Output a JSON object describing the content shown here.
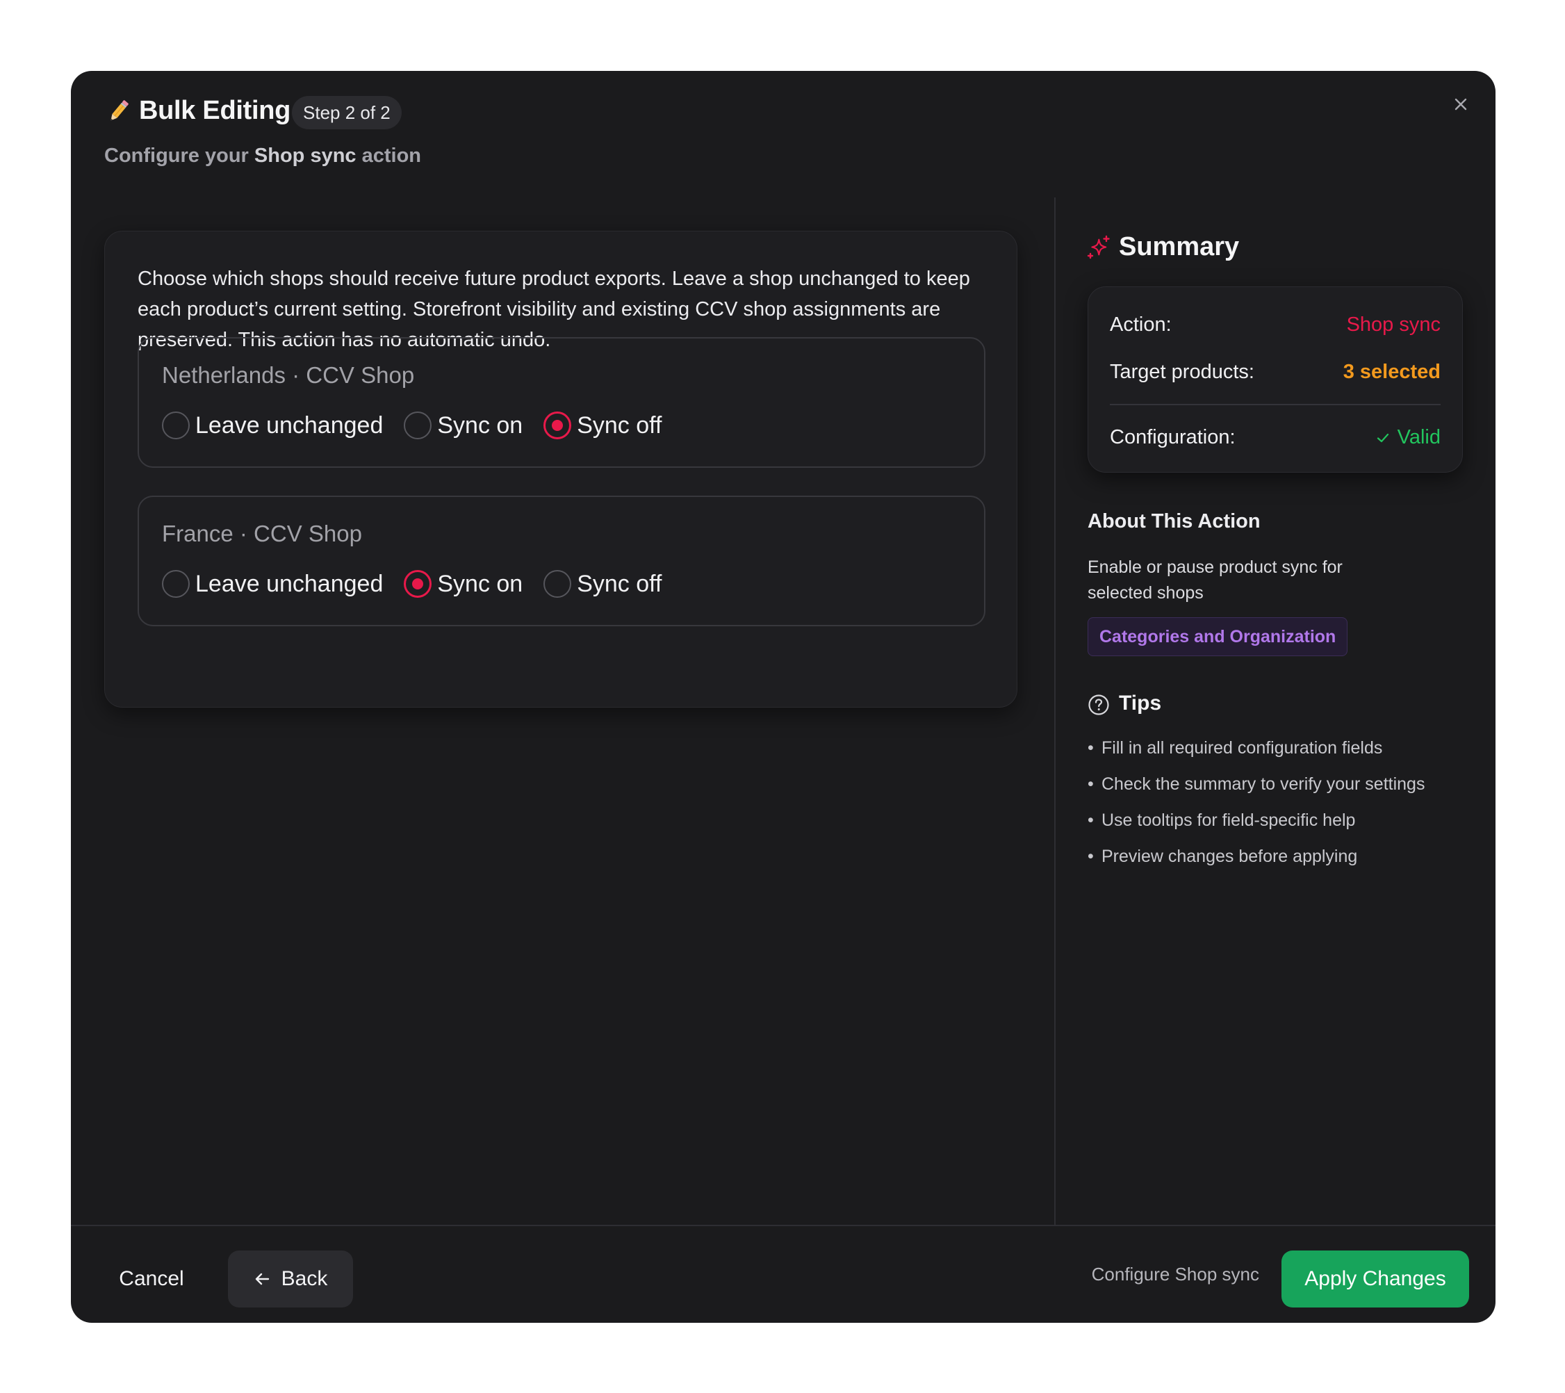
{
  "header": {
    "icon": "pencil-icon",
    "title": "Bulk Editing",
    "step_badge": "Step 2 of 2",
    "subtitle_prefix": "Configure your",
    "subtitle_action": "Shop sync",
    "subtitle_suffix": "action",
    "close_icon": "close-icon"
  },
  "main": {
    "description": "Choose which shops should receive future product exports. Leave a shop unchanged to keep each product’s current setting. Storefront visibility and existing CCV shop assignments are preserved. This action has no automatic undo.",
    "shops": [
      {
        "title": "Netherlands · CCV Shop",
        "options": [
          "Leave unchanged",
          "Sync on",
          "Sync off"
        ],
        "selected": "Sync off"
      },
      {
        "title": "France · CCV Shop",
        "options": [
          "Leave unchanged",
          "Sync on",
          "Sync off"
        ],
        "selected": "Sync on"
      }
    ]
  },
  "summary": {
    "title": "Summary",
    "icon": "sparkles-icon",
    "action_label": "Action:",
    "action_value": "Shop sync",
    "target_label": "Target products:",
    "target_value": "3 selected",
    "config_label": "Configuration:",
    "config_value": "Valid"
  },
  "about": {
    "title": "About This Action",
    "description": "Enable or pause product sync for selected shops",
    "category": "Categories and Organization"
  },
  "tips": {
    "title": "Tips",
    "icon": "help-circle-icon",
    "items": [
      "Fill in all required configuration fields",
      "Check the summary to verify your settings",
      "Use tooltips for field-specific help",
      "Preview changes before applying"
    ]
  },
  "footer": {
    "cancel_label": "Cancel",
    "back_label": "Back",
    "hint": "Configure Shop sync",
    "apply_label": "Apply Changes"
  },
  "colors": {
    "accent_pink": "#e8194a",
    "accent_orange": "#f39a1e",
    "accent_green": "#22c55e",
    "apply_button": "#17a45b",
    "category_purple": "#b178ea",
    "modal_background": "#1b1b1d"
  }
}
